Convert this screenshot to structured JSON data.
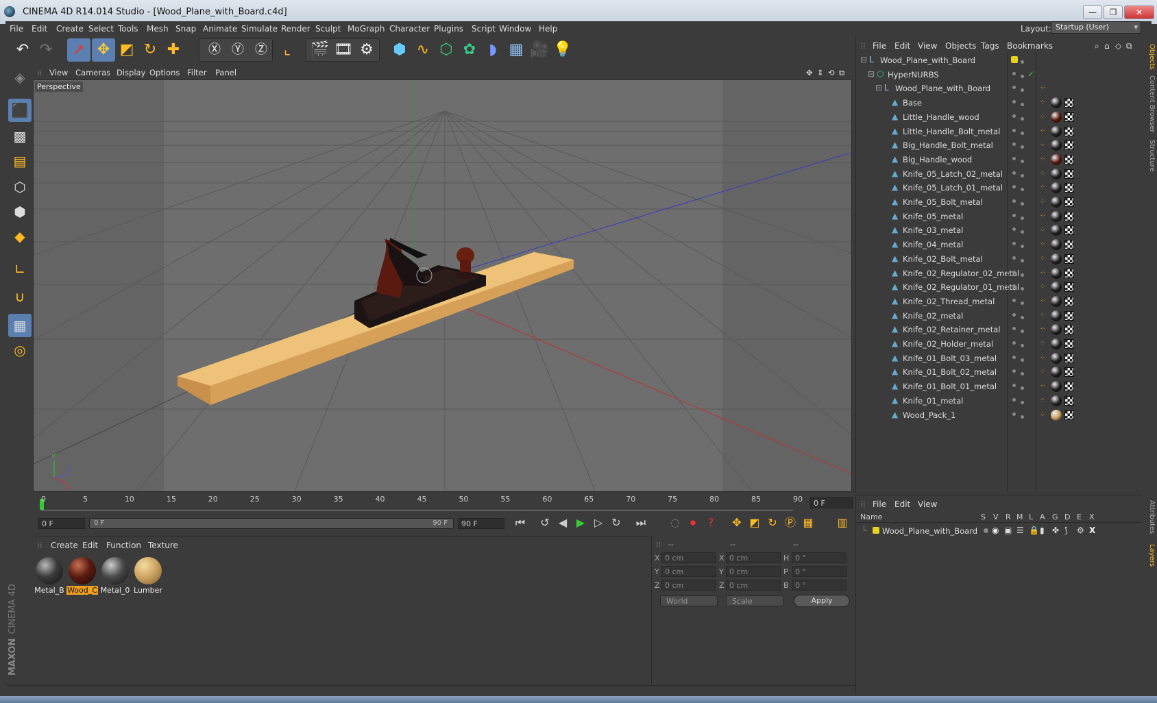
{
  "window": {
    "title": "CINEMA 4D R14.014 Studio - [Wood_Plane_with_Board.c4d]",
    "buttons": [
      "—",
      "❐",
      "✕"
    ]
  },
  "menu": [
    "File",
    "Edit",
    "Create",
    "Select",
    "Tools",
    "Mesh",
    "Snap",
    "Animate",
    "Simulate",
    "Render",
    "Sculpt",
    "MoGraph",
    "Character",
    "Plugins",
    "Script",
    "Window",
    "Help"
  ],
  "layout": {
    "label": "Layout:",
    "value": "Startup (User)"
  },
  "viewport": {
    "menu": [
      "View",
      "Cameras",
      "Display",
      "Options",
      "Filter",
      "Panel"
    ],
    "label": "Perspective"
  },
  "timeline": {
    "ticks": [
      "0",
      "5",
      "10",
      "15",
      "20",
      "25",
      "30",
      "35",
      "40",
      "45",
      "50",
      "55",
      "60",
      "65",
      "70",
      "75",
      "80",
      "85",
      "90"
    ],
    "current_frame": "0 F",
    "start_field": "0 F",
    "slider_start": "0 F",
    "slider_end": "90 F",
    "end_field": "90 F"
  },
  "materials": {
    "menu": [
      "Create",
      "Edit",
      "Function",
      "Texture"
    ],
    "items": [
      {
        "label": "Metal_B",
        "color": "#3a3a3a",
        "selected": false
      },
      {
        "label": "Wood_C",
        "color": "#5a1a10",
        "selected": true
      },
      {
        "label": "Metal_0",
        "color": "#4a4a4a",
        "selected": false
      },
      {
        "label": "Lumber",
        "color": "#c8a060",
        "selected": false
      }
    ]
  },
  "coords": {
    "headers": [
      "--",
      "--",
      "--"
    ],
    "rows": [
      {
        "a1": "X",
        "v1": "0 cm",
        "a2": "X",
        "v2": "0 cm",
        "a3": "H",
        "v3": "0 °"
      },
      {
        "a1": "Y",
        "v1": "0 cm",
        "a2": "Y",
        "v2": "0 cm",
        "a3": "P",
        "v3": "0 °"
      },
      {
        "a1": "Z",
        "v1": "0 cm",
        "a2": "Z",
        "v2": "0 cm",
        "a3": "B",
        "v3": "0 °"
      }
    ],
    "mode1": "World",
    "mode2": "Scale",
    "apply": "Apply"
  },
  "objects": {
    "menu": [
      "File",
      "Edit",
      "View",
      "Objects",
      "Tags",
      "Bookmarks"
    ],
    "tree": [
      {
        "name": "Wood_Plane_with_Board",
        "level": 0,
        "icon": "null"
      },
      {
        "name": "HyperNURBS",
        "level": 1,
        "icon": "nurbs"
      },
      {
        "name": "Wood_Plane_with_Board",
        "level": 2,
        "icon": "null"
      },
      {
        "name": "Base",
        "level": 3,
        "icon": "poly",
        "mat": "#222222"
      },
      {
        "name": "Little_Handle_wood",
        "level": 3,
        "icon": "poly",
        "mat": "#5a1a10"
      },
      {
        "name": "Little_Handle_Bolt_metal",
        "level": 3,
        "icon": "poly",
        "mat": "#222222"
      },
      {
        "name": "Big_Handle_Bolt_metal",
        "level": 3,
        "icon": "poly",
        "mat": "#222222"
      },
      {
        "name": "Big_Handle_wood",
        "level": 3,
        "icon": "poly",
        "mat": "#5a1a10"
      },
      {
        "name": "Knife_05_Latch_02_metal",
        "level": 3,
        "icon": "poly",
        "mat": "#222222"
      },
      {
        "name": "Knife_05_Latch_01_metal",
        "level": 3,
        "icon": "poly",
        "mat": "#222222"
      },
      {
        "name": "Knife_05_Bolt_metal",
        "level": 3,
        "icon": "poly",
        "mat": "#222222"
      },
      {
        "name": "Knife_05_metal",
        "level": 3,
        "icon": "poly",
        "mat": "#222222"
      },
      {
        "name": "Knife_03_metal",
        "level": 3,
        "icon": "poly",
        "mat": "#222222"
      },
      {
        "name": "Knife_04_metal",
        "level": 3,
        "icon": "poly",
        "mat": "#222222"
      },
      {
        "name": "Knife_02_Bolt_metal",
        "level": 3,
        "icon": "poly",
        "mat": "#222222"
      },
      {
        "name": "Knife_02_Regulator_02_metal",
        "level": 3,
        "icon": "poly",
        "mat": "#222222"
      },
      {
        "name": "Knife_02_Regulator_01_metal",
        "level": 3,
        "icon": "poly",
        "mat": "#222222"
      },
      {
        "name": "Knife_02_Thread_metal",
        "level": 3,
        "icon": "poly",
        "mat": "#222222"
      },
      {
        "name": "Knife_02_metal",
        "level": 3,
        "icon": "poly",
        "mat": "#222222"
      },
      {
        "name": "Knife_02_Retainer_metal",
        "level": 3,
        "icon": "poly",
        "mat": "#222222"
      },
      {
        "name": "Knife_02_Holder_metal",
        "level": 3,
        "icon": "poly",
        "mat": "#222222"
      },
      {
        "name": "Knife_01_Bolt_03_metal",
        "level": 3,
        "icon": "poly",
        "mat": "#222222"
      },
      {
        "name": "Knife_01_Bolt_02_metal",
        "level": 3,
        "icon": "poly",
        "mat": "#222222"
      },
      {
        "name": "Knife_01_Bolt_01_metal",
        "level": 3,
        "icon": "poly",
        "mat": "#222222"
      },
      {
        "name": "Knife_01_metal",
        "level": 3,
        "icon": "poly",
        "mat": "#222222"
      },
      {
        "name": "Wood_Pack_1",
        "level": 3,
        "icon": "poly",
        "mat": "#c8a060"
      }
    ]
  },
  "layers": {
    "menu": [
      "File",
      "Edit",
      "View"
    ],
    "columns": [
      "Name",
      "S",
      "V",
      "R",
      "M",
      "L",
      "A",
      "G",
      "D",
      "E",
      "X"
    ],
    "rows": [
      {
        "name": "Wood_Plane_with_Board",
        "color": "#e6d020"
      }
    ]
  },
  "right_tabs": [
    "Objects",
    "Content Browser",
    "Structure",
    "Attributes",
    "Layers"
  ],
  "brand": {
    "maxon": "MAXON",
    "product": "CINEMA 4D"
  }
}
